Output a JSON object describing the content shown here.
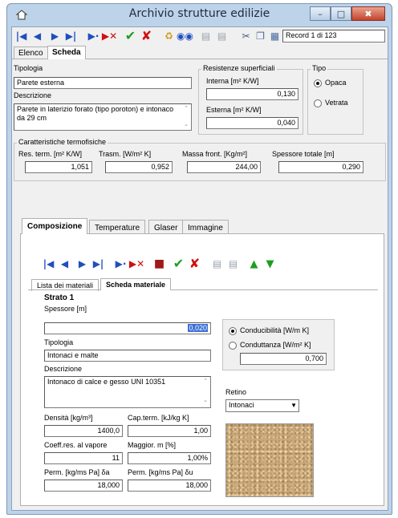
{
  "window": {
    "title": "Archivio strutture edilizie",
    "record_label": "Record 1 di 123"
  },
  "caption_buttons": {
    "minimize": "–",
    "maximize": "□",
    "close": "✖"
  },
  "top_tabs": [
    "Elenco",
    "Scheda"
  ],
  "scheda": {
    "tipologia_label": "Tipologia",
    "tipologia_value": "Parete esterna",
    "descrizione_label": "Descrizione",
    "descrizione_value": "Parete in laterizio forato (tipo poroton) e intonaco da 29 cm",
    "resistenze_group": "Resistenze superficiali",
    "interna_label": "Interna [m² K/W]",
    "interna_value": "0,130",
    "esterna_label": "Esterna  [m² K/W]",
    "esterna_value": "0,040",
    "tipo_group": "Tipo",
    "tipo_options": [
      "Opaca",
      "Vetrata"
    ],
    "tipo_selected": "Opaca",
    "caratteristiche_group": "Caratteristiche termofisiche",
    "res_term_label": "Res. term. [m² K/W]",
    "res_term_value": "1,051",
    "trasm_label": "Trasm. [W/m² K]",
    "trasm_value": "0,952",
    "massa_label": "Massa front. [Kg/m²]",
    "massa_value": "244,00",
    "spessore_tot_label": "Spessore totale [m]",
    "spessore_tot_value": "0,290"
  },
  "inner_tabs": [
    "Composizione",
    "Temperature",
    "Glaser",
    "Immagine"
  ],
  "material_tabs": [
    "Lista dei materiali",
    "Scheda materiale"
  ],
  "strato": {
    "title": "Strato 1",
    "spessore_label": "Spessore [m]",
    "spessore_value": "0,020",
    "tipologia_label": "Tipologia",
    "tipologia_value": "Intonaci e malte",
    "descrizione_label": "Descrizione",
    "descrizione_value": "Intonaco di calce e gesso UNI 10351",
    "conducibilita_label": "Conducibilità [W/m K]",
    "conduttanza_label": "Conduttanza [W/m² K]",
    "conduzione_value": "0,700",
    "conduzione_selected": "Conducibilità [W/m K]",
    "retino_label": "Retino",
    "retino_value": "Intonaci",
    "densita_label": "Densità [kg/m³]",
    "densita_value": "1400,0",
    "cap_term_label": "Cap.term. [kJ/kg K]",
    "cap_term_value": "1,00",
    "coeff_label": "Coeff.res. al vapore",
    "coeff_value": "11",
    "maggior_label": "Maggior. m [%]",
    "maggior_value": "1,00%",
    "perm_a_label": "Perm. [kg/ms Pa] δa",
    "perm_a_value": "18,000",
    "perm_u_label": "Perm. [kg/ms Pa] δu",
    "perm_u_value": "18,000"
  }
}
